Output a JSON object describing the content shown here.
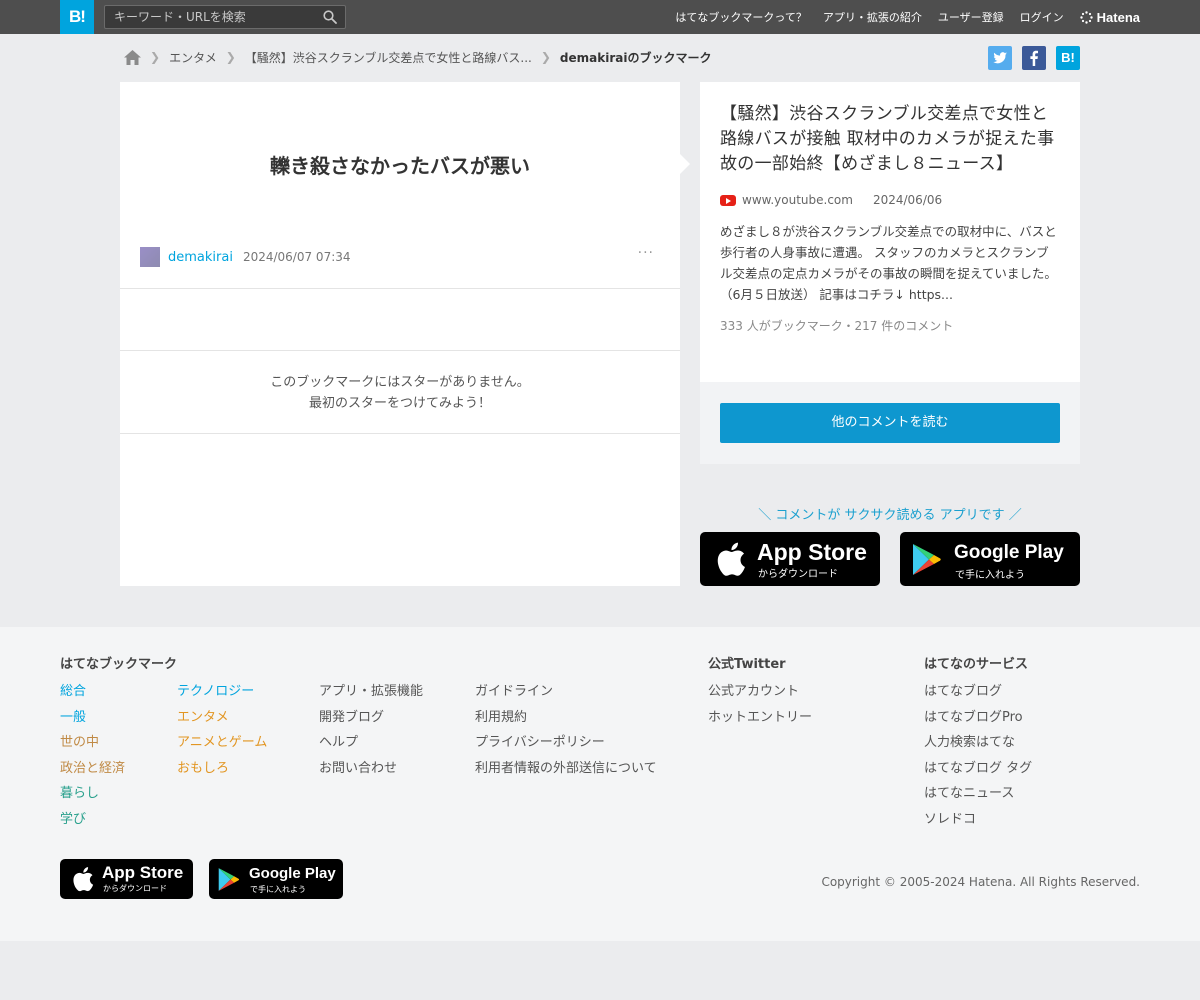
{
  "header": {
    "logo": "B!",
    "search_placeholder": "キーワード・URLを検索",
    "nav": [
      "はてなブックマークって？",
      "アプリ・拡張の紹介",
      "ユーザー登録",
      "ログイン"
    ],
    "brand": "Hatena"
  },
  "breadcrumb": {
    "category": "エンタメ",
    "entry": "【騒然】渋谷スクランブル交差点で女性と路線バス...",
    "current": "demakiraiのブックマーク"
  },
  "share": {
    "hatena": "B!"
  },
  "bookmark": {
    "comment": "轢き殺さなかったバスが悪い",
    "user": "demakirai",
    "datetime": "2024/06/07 07:34",
    "more": "···",
    "no_stars_line1": "このブックマークにはスターがありません。",
    "no_stars_line2": "最初のスターをつけてみよう！"
  },
  "entry": {
    "title": "【騒然】渋谷スクランブル交差点で女性と路線バスが接触 取材中のカメラが捉えた事故の一部始終【めざまし８ニュース】",
    "domain": "www.youtube.com",
    "date": "2024/06/06",
    "summary": "めざまし８が渋谷スクランブル交差点での取材中に、バスと歩行者の人身事故に遭遇。 スタッフのカメラとスクランブル交差点の定点カメラがその事故の瞬間を捉えていました。 （6月５日放送） 記事はコチラ↓ https...",
    "counts": "333 人がブックマーク・217 件のコメント",
    "read_more": "他のコメントを読む"
  },
  "app_promo": {
    "tagline": "＼ コメントが サクサク読める アプリです ／",
    "appstore_big": "App Store",
    "appstore_small": "からダウンロード",
    "googleplay_big": "Google Play",
    "googleplay_small": "で手に入れよう"
  },
  "footer": {
    "col1_head": "はてなブックマーク",
    "categories_a": [
      "総合",
      "一般",
      "世の中",
      "政治と経済",
      "暮らし",
      "学び"
    ],
    "categories_b": [
      "テクノロジー",
      "エンタメ",
      "アニメとゲーム",
      "おもしろ"
    ],
    "links_a": [
      "アプリ・拡張機能",
      "開発ブログ",
      "ヘルプ",
      "お問い合わせ"
    ],
    "links_b": [
      "ガイドライン",
      "利用規約",
      "プライバシーポリシー",
      "利用者情報の外部送信について"
    ],
    "twitter_head": "公式Twitter",
    "twitter_links": [
      "公式アカウント",
      "ホットエントリー"
    ],
    "services_head": "はてなのサービス",
    "services": [
      "はてなブログ",
      "はてなブログPro",
      "人力検索はてな",
      "はてなブログ タグ",
      "はてなニュース",
      "ソレドコ"
    ],
    "copyright": "Copyright © 2005-2024 Hatena. All Rights Reserved."
  },
  "colors": {
    "accent": "#00a4de",
    "topbar": "#4e4e4e",
    "button": "#0e97cf",
    "twitter": "#55acee",
    "facebook": "#3b5998"
  }
}
